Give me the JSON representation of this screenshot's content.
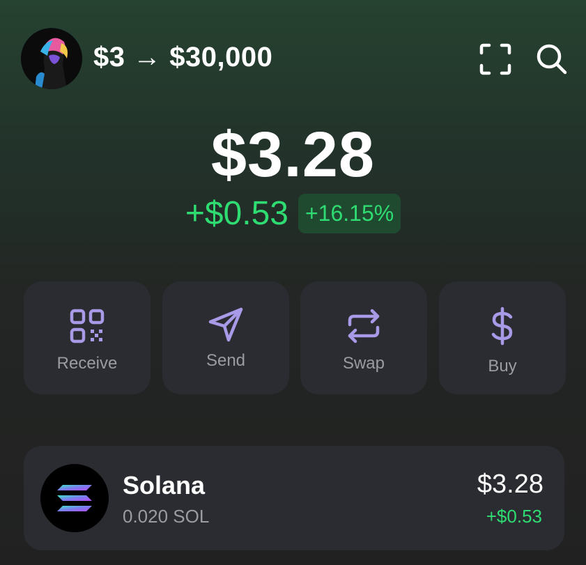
{
  "header": {
    "account_name": "$3 → $30,000",
    "scan_icon": "scan-icon",
    "search_icon": "search-icon"
  },
  "balance": {
    "total": "$3.28",
    "change_amount": "+$0.53",
    "change_percent": "+16.15%"
  },
  "actions": [
    {
      "label": "Receive",
      "icon": "qr-code-icon"
    },
    {
      "label": "Send",
      "icon": "send-icon"
    },
    {
      "label": "Swap",
      "icon": "swap-icon"
    },
    {
      "label": "Buy",
      "icon": "dollar-icon"
    }
  ],
  "tokens": [
    {
      "name": "Solana",
      "amount": "0.020 SOL",
      "value": "$3.28",
      "change": "+$0.53",
      "icon": "solana-logo-icon"
    }
  ],
  "colors": {
    "positive": "#2fdc72",
    "accent_icon": "#a99ae8",
    "card_bg": "#2b2c31"
  }
}
